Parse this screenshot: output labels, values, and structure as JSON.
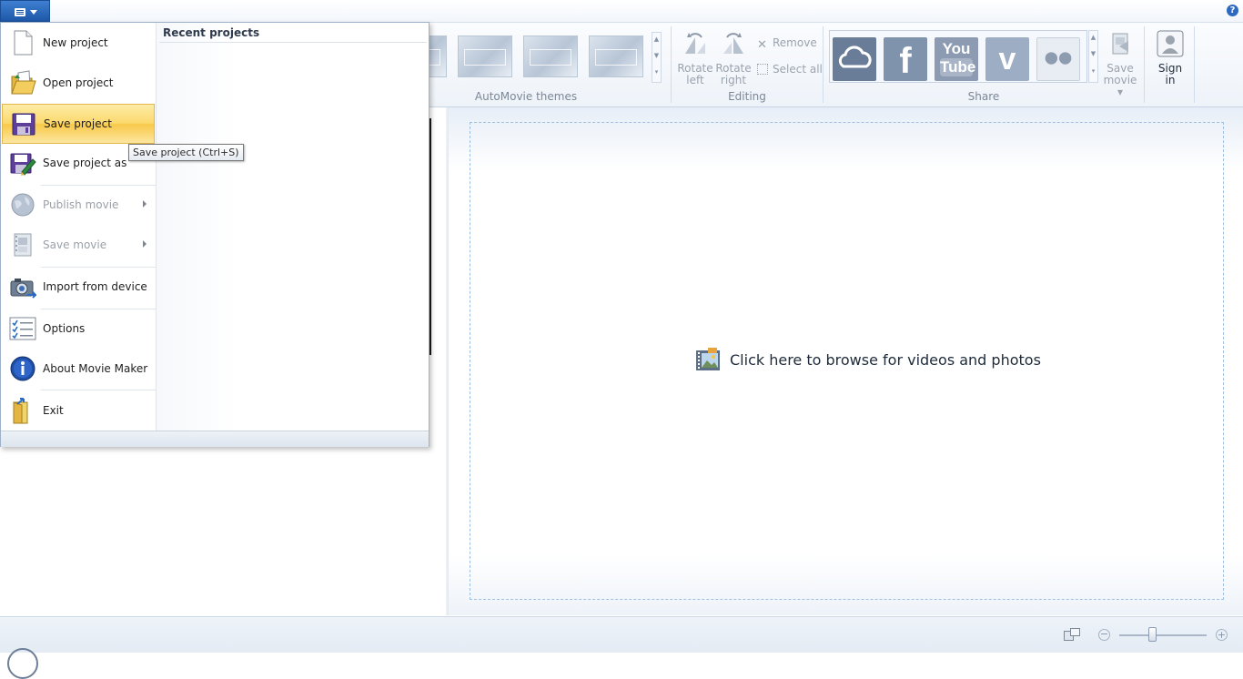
{
  "app_menu": {
    "items": [
      {
        "label": "New project",
        "enabled": true,
        "icon": "new-document-icon"
      },
      {
        "label": "Open project",
        "enabled": true,
        "icon": "open-folder-icon"
      },
      {
        "label": "Save project",
        "enabled": true,
        "icon": "floppy-disk-icon",
        "selected": true
      },
      {
        "label": "Save project as",
        "enabled": true,
        "icon": "save-as-icon"
      },
      {
        "label": "Publish movie",
        "enabled": false,
        "icon": "globe-icon",
        "submenu": true
      },
      {
        "label": "Save movie",
        "enabled": false,
        "icon": "film-icon",
        "submenu": true
      },
      {
        "label": "Import from device",
        "enabled": true,
        "icon": "camera-icon"
      },
      {
        "label": "Options",
        "enabled": true,
        "icon": "checklist-icon"
      },
      {
        "label": "About Movie Maker",
        "enabled": true,
        "icon": "info-icon"
      },
      {
        "label": "Exit",
        "enabled": true,
        "icon": "exit-door-icon"
      }
    ],
    "recent_title": "Recent projects"
  },
  "tooltip": "Save project (Ctrl+S)",
  "ribbon": {
    "groups": {
      "automovie_themes": "AutoMovie themes",
      "editing": "Editing",
      "share": "Share"
    },
    "editing": {
      "rotate_left": [
        "Rotate",
        "left"
      ],
      "rotate_right": [
        "Rotate",
        "right"
      ],
      "remove": "Remove",
      "select_all": "Select all"
    },
    "share": {
      "tiles": [
        "onedrive",
        "facebook",
        "youtube",
        "vimeo",
        "flickr"
      ],
      "save_movie": [
        "Save",
        "movie"
      ],
      "youtube_text": [
        "You",
        "Tube"
      ],
      "facebook_text": "f"
    },
    "sign_in": [
      "Sign",
      "in"
    ]
  },
  "storyboard": {
    "browse_text": "Click here to browse for videos and photos"
  },
  "colors": {
    "accent": "#1d58a8",
    "menu_highlight": "#fbd96d",
    "share_tile": "#6a7d98",
    "drop_border": "#9fbfe0"
  },
  "status": {
    "zoom_level": 0.38
  }
}
